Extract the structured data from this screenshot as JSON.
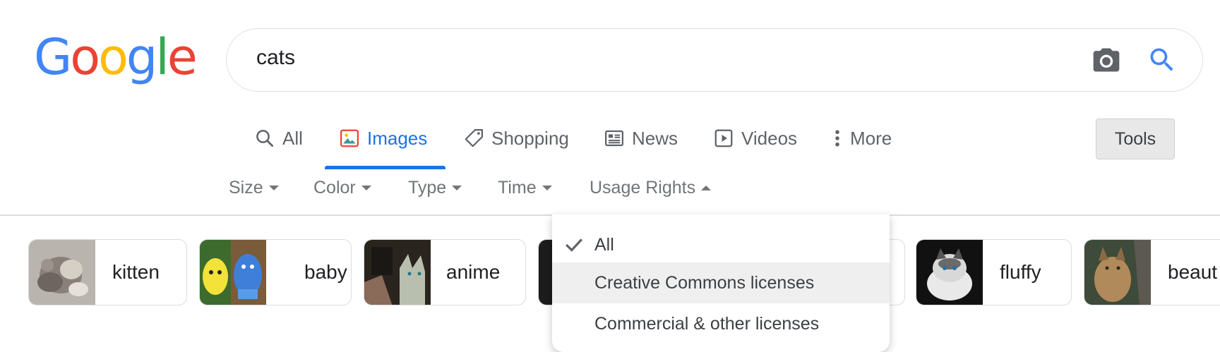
{
  "logo": {
    "letters": [
      "G",
      "o",
      "o",
      "g",
      "l",
      "e"
    ],
    "colors": [
      "#4285f4",
      "#ea4335",
      "#fbbc05",
      "#4285f4",
      "#34a853",
      "#ea4335"
    ]
  },
  "search": {
    "query": "cats",
    "camera_icon": "camera-icon",
    "search_icon": "search-icon"
  },
  "tabs": [
    {
      "label": "All",
      "icon": "search-icon"
    },
    {
      "label": "Images",
      "icon": "image-icon",
      "active": true
    },
    {
      "label": "Shopping",
      "icon": "tag-icon"
    },
    {
      "label": "News",
      "icon": "news-icon"
    },
    {
      "label": "Videos",
      "icon": "play-icon"
    },
    {
      "label": "More",
      "icon": "more-vert-icon"
    }
  ],
  "tools_label": "Tools",
  "filters": [
    {
      "label": "Size",
      "caret": "down"
    },
    {
      "label": "Color",
      "caret": "down"
    },
    {
      "label": "Type",
      "caret": "down"
    },
    {
      "label": "Time",
      "caret": "down"
    },
    {
      "label": "Usage Rights",
      "caret": "up"
    }
  ],
  "chips": [
    "kitten",
    "baby",
    "anime",
    "",
    "fluffy",
    "beaut"
  ],
  "usage_rights_menu": {
    "items": [
      {
        "label": "All",
        "checked": true
      },
      {
        "label": "Creative Commons licenses",
        "highlighted": true
      },
      {
        "label": "Commercial & other licenses"
      }
    ]
  },
  "colors": {
    "accent": "#1a73e8"
  }
}
